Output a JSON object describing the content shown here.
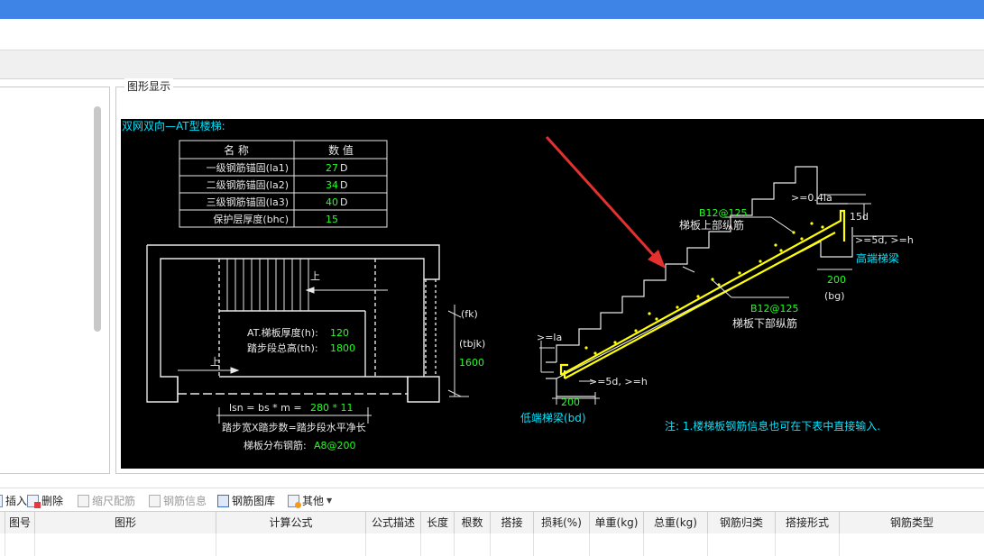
{
  "panel": {
    "title": "图形显示"
  },
  "drawing": {
    "heading": "双网双向—AT型楼梯:",
    "table": {
      "header": [
        "名 称",
        "数 值"
      ],
      "rows": [
        {
          "name": "一级钢筋锚固(la1)",
          "value": "27",
          "unit": "D"
        },
        {
          "name": "二级钢筋锚固(la2)",
          "value": "34",
          "unit": "D"
        },
        {
          "name": "三级钢筋锚固(la3)",
          "value": "40",
          "unit": "D"
        },
        {
          "name": "保护层厚度(bhc)",
          "value": "15",
          "unit": ""
        }
      ]
    },
    "plan": {
      "up1": "上",
      "up2": "上",
      "thickness_label": "AT.梯板厚度(h):",
      "thickness_value": "120",
      "height_label": "踏步段总高(th):",
      "height_value": "1800",
      "fk": "(fk)",
      "tbjk": "(tbjk)",
      "tbjk_value": "1600",
      "lsn_prefix": "lsn = bs * m =",
      "lsn_values": "280 * 11",
      "formula": "踏步宽X踏步数=踏步段水平净长",
      "dist_label": "梯板分布钢筋:",
      "dist_value": "A8@200"
    },
    "section": {
      "top_rebar_code": "B12@125",
      "top_rebar_label": "梯板上部纵筋",
      "bottom_rebar_code": "B12@125",
      "bottom_rebar_label": "梯板下部纵筋",
      "dim_04la": ">=0.4la",
      "dim_15d": "15d",
      "dim_5d_h_top": ">=5d, >=h",
      "high_beam": "高端梯梁",
      "dim_200_top": "200",
      "bg": "(bg)",
      "dim_la": ">=la",
      "dim_5d_h_bottom": ">=5d, >=h",
      "dim_200_bottom": "200",
      "low_beam": "低端梯梁(bd)",
      "note": "注: 1.楼梯板钢筋信息也可在下表中直接输入."
    }
  },
  "bottom_toolbar": [
    {
      "label": "插入",
      "icon": "insert-icon",
      "enabled": true
    },
    {
      "label": "删除",
      "icon": "delete-icon",
      "enabled": true
    },
    {
      "label": "缩尺配筋",
      "icon": "scale-rebar-icon",
      "enabled": false
    },
    {
      "label": "钢筋信息",
      "icon": "rebar-info-icon",
      "enabled": false
    },
    {
      "label": "钢筋图库",
      "icon": "rebar-library-icon",
      "enabled": true
    },
    {
      "label": "其他",
      "icon": "other-icon",
      "enabled": true
    }
  ],
  "grid": {
    "columns": [
      "",
      "图号",
      "图形",
      "计算公式",
      "公式描述",
      "长度",
      "根数",
      "搭接",
      "损耗(%)",
      "单重(kg)",
      "总重(kg)",
      "钢筋归类",
      "搭接形式",
      "钢筋类型"
    ]
  },
  "colors": {
    "titlebar": "#3d84e6",
    "canvas": "#000000",
    "heading": "#00e5ff",
    "value": "#22ff22",
    "rebar": "#ffff00",
    "arrow": "#e53030"
  }
}
